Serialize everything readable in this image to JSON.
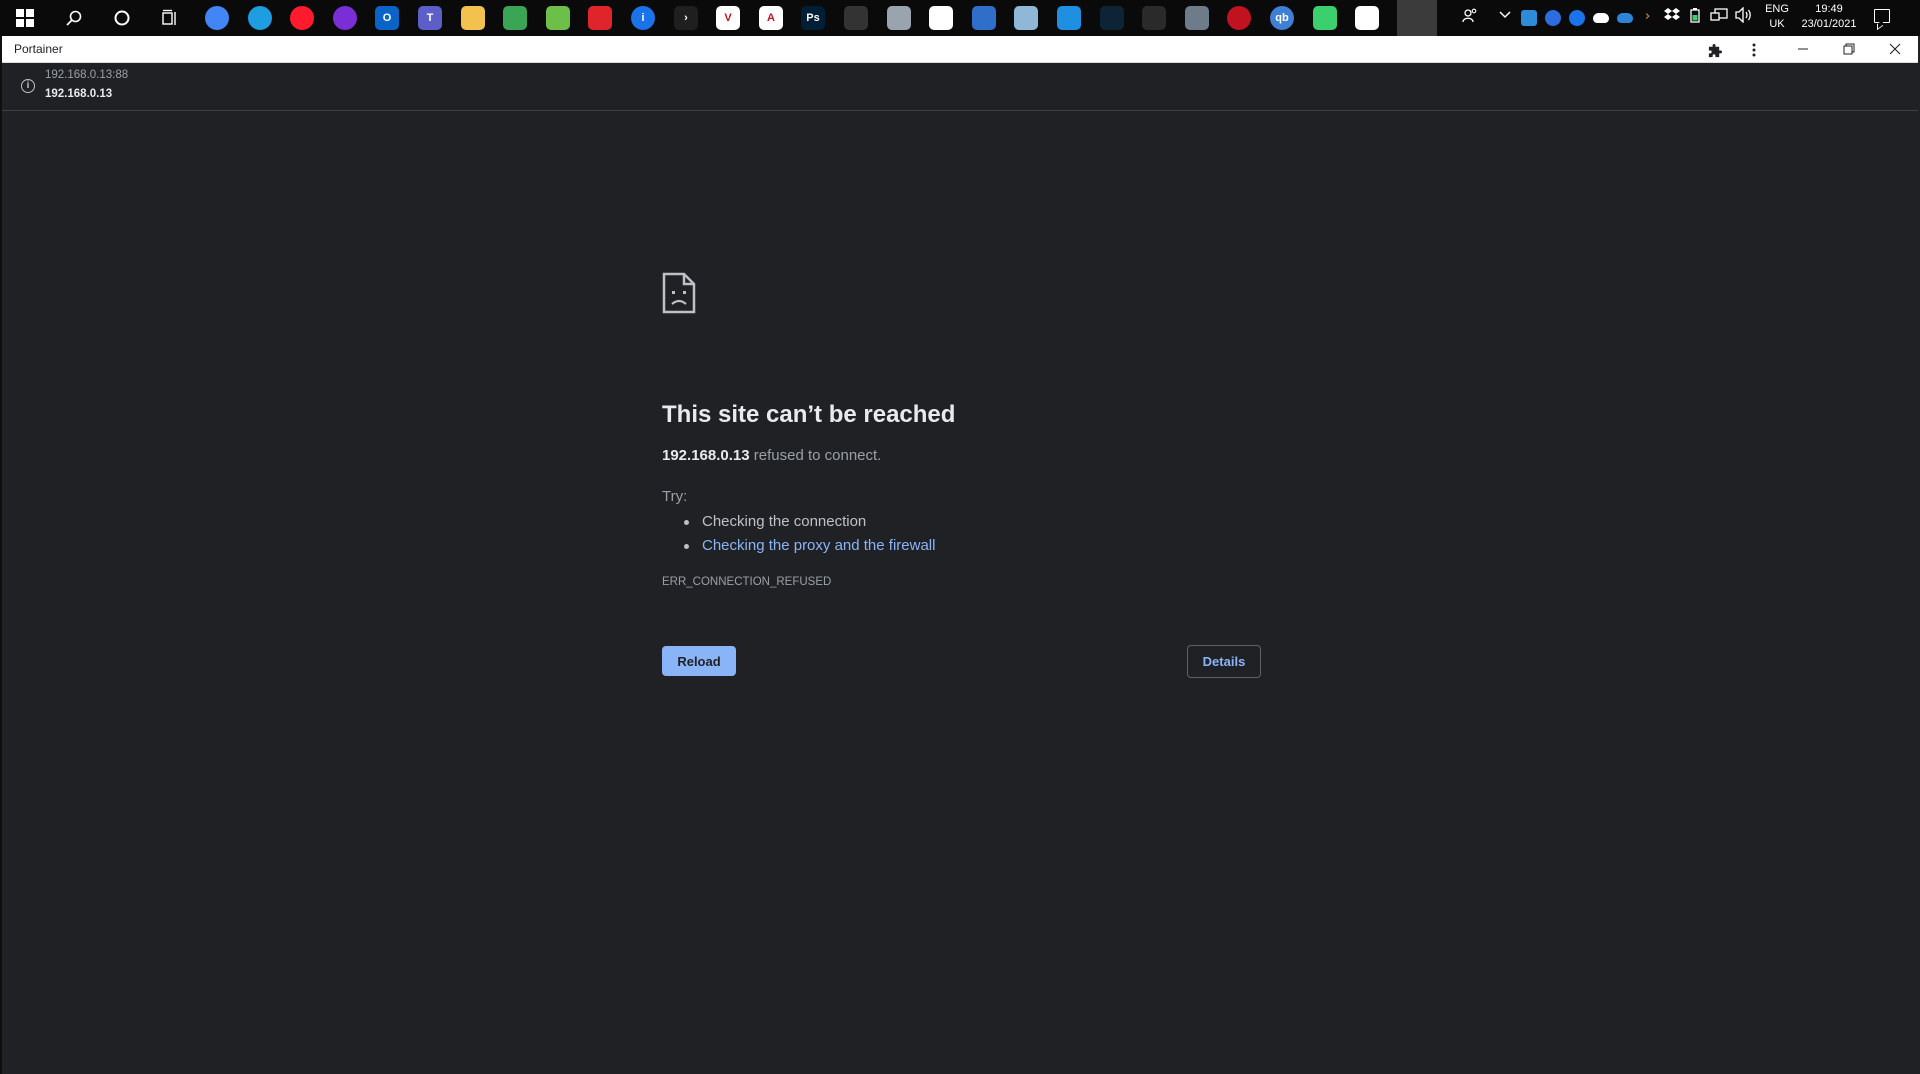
{
  "taskbar": {
    "pinned_apps": [
      {
        "icon": "chrome-icon",
        "color": "#4285f4",
        "glyph": ""
      },
      {
        "icon": "edge-icon",
        "color": "#1e9de0",
        "glyph": ""
      },
      {
        "icon": "opera-icon",
        "color": "#ff1b2d",
        "glyph": ""
      },
      {
        "icon": "podcast-icon",
        "color": "#7a2ed6",
        "glyph": ""
      },
      {
        "icon": "outlook-icon",
        "color": "#0a64c8",
        "glyph": "O"
      },
      {
        "icon": "teams-icon",
        "color": "#5b5fc7",
        "glyph": "T"
      },
      {
        "icon": "file-explorer-icon",
        "color": "#f2c14e",
        "glyph": ""
      },
      {
        "icon": "maps-icon",
        "color": "#3aa655",
        "glyph": ""
      },
      {
        "icon": "lime-app-icon",
        "color": "#6cc04a",
        "glyph": ""
      },
      {
        "icon": "screen-recorder-icon",
        "color": "#e0242c",
        "glyph": ""
      },
      {
        "icon": "password-manager-icon",
        "color": "#1a73e8",
        "glyph": "i"
      },
      {
        "icon": "plex-icon",
        "color": "#1f1f1f",
        "glyph": "›"
      },
      {
        "icon": "vnc-viewer-icon",
        "color": "#ffffff",
        "glyph": "V"
      },
      {
        "icon": "acrobat-icon",
        "color": "#ffffff",
        "glyph": "A"
      },
      {
        "icon": "photoshop-icon",
        "color": "#001e36",
        "glyph": "Ps"
      },
      {
        "icon": "inkscape-icon",
        "color": "#333333",
        "glyph": ""
      },
      {
        "icon": "cloud-app-icon",
        "color": "#9aa4ae",
        "glyph": ""
      },
      {
        "icon": "microsoft-store-icon",
        "color": "#ffffff",
        "glyph": ""
      },
      {
        "icon": "remote-desktop-icon",
        "color": "#2f6fc9",
        "glyph": ""
      },
      {
        "icon": "globe-app-icon",
        "color": "#8fb7d8",
        "glyph": ""
      },
      {
        "icon": "settings-app-icon",
        "color": "#1e8fe1",
        "glyph": ""
      },
      {
        "icon": "terminal-app-icon",
        "color": "#0d2436",
        "glyph": ""
      },
      {
        "icon": "virtual-desktop-icon",
        "color": "#2a2a2a",
        "glyph": ""
      },
      {
        "icon": "calculator-icon",
        "color": "#6d7b8a",
        "glyph": ""
      },
      {
        "icon": "red-app-icon",
        "color": "#c1121f",
        "glyph": ""
      },
      {
        "icon": "qbittorrent-icon",
        "color": "#3f7fd6",
        "glyph": "qb"
      },
      {
        "icon": "green-bolt-app-icon",
        "color": "#3ccf6e",
        "glyph": ""
      },
      {
        "icon": "panda-app-icon",
        "color": "#ffffff",
        "glyph": ""
      },
      {
        "icon": "portainer-icon",
        "color": "#13bef9",
        "glyph": ""
      }
    ],
    "language": {
      "line1": "ENG",
      "line2": "UK"
    },
    "clock": {
      "time": "19:49",
      "date": "23/01/2021"
    }
  },
  "window": {
    "title": "Portainer"
  },
  "address": {
    "url": "192.168.0.13:88",
    "host": "192.168.0.13"
  },
  "error": {
    "title": "This site can’t be reached",
    "host": "192.168.0.13",
    "detail_suffix": " refused to connect.",
    "try_label": "Try:",
    "suggestions": [
      "Checking the connection",
      "Checking the proxy and the firewall"
    ],
    "code": "ERR_CONNECTION_REFUSED",
    "reload_label": "Reload",
    "details_label": "Details"
  },
  "colors": {
    "page_background": "#202124",
    "link": "#8ab4f8",
    "primary_button": "#8ab4f8"
  }
}
